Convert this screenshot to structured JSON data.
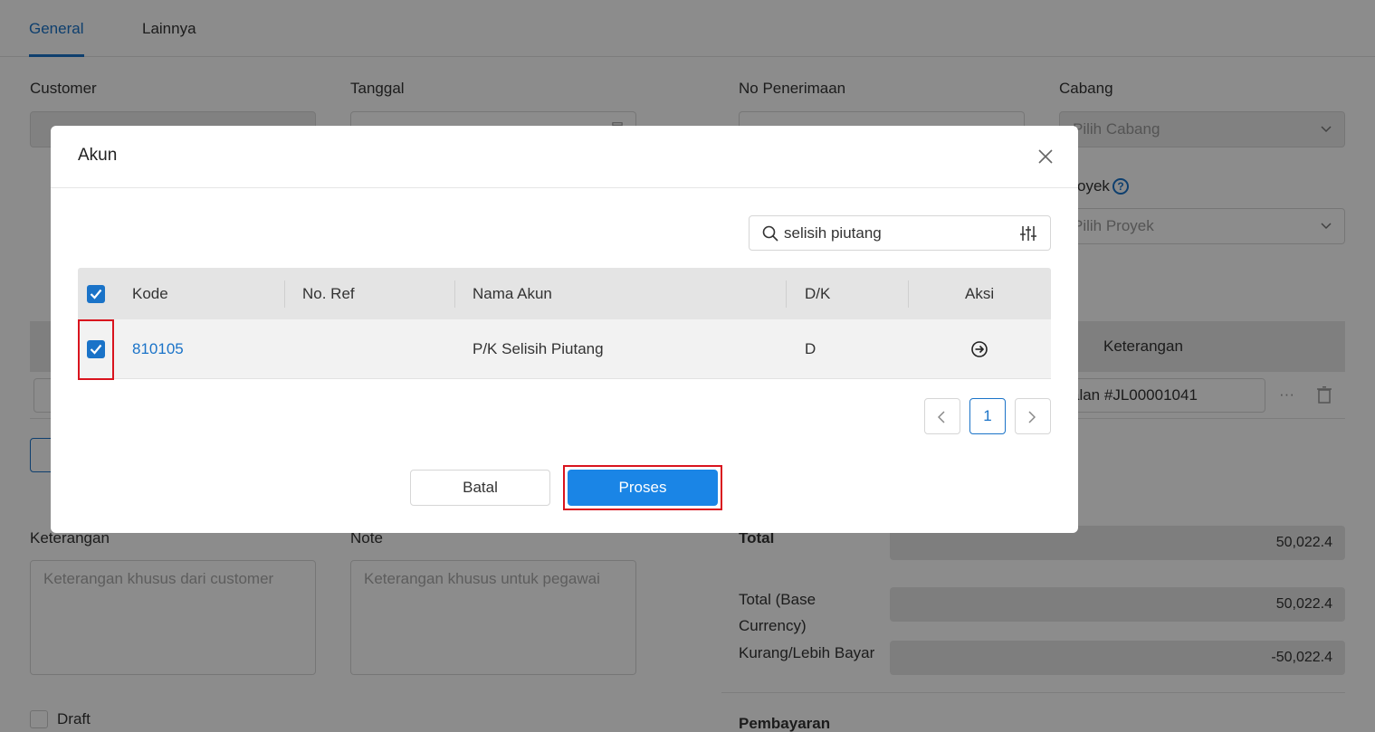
{
  "tabs": [
    {
      "label": "General"
    },
    {
      "label": "Lainnya"
    }
  ],
  "form": {
    "customer_label": "Customer",
    "customer_value": "",
    "tanggal_label": "Tanggal",
    "tanggal_value": "",
    "no_penerimaan_label": "No Penerimaan",
    "no_penerimaan_value": "",
    "cabang_label": "Cabang",
    "cabang_placeholder": "Pilih Cabang",
    "proyek_label": "oyek",
    "proyek_placeholder": "Pilih Proyek",
    "help_glyph": "?"
  },
  "bg_table": {
    "keterangan_header": "Keterangan",
    "row_keterangan_value": "alan #JL00001041",
    "row_more_glyph": "···"
  },
  "bottom": {
    "keterangan_label": "Keterangan",
    "keterangan_placeholder": "Keterangan khusus dari customer",
    "note_label": "Note",
    "note_placeholder": "Keterangan khusus untuk pegawai",
    "draft_label": "Draft",
    "total_label": "Total",
    "total_value": "50,022.4",
    "total_base_label_1": "Total (Base",
    "total_base_label_2": "Currency)",
    "total_base_value": "50,022.4",
    "kurang_label": "Kurang/Lebih Bayar",
    "kurang_value": "-50,022.4",
    "pembayaran_label": "Pembayaran"
  },
  "modal": {
    "title": "Akun",
    "search_value": "selisih piutang",
    "columns": {
      "kode": "Kode",
      "no_ref": "No. Ref",
      "nama_akun": "Nama Akun",
      "dk": "D/K",
      "aksi": "Aksi"
    },
    "rows": [
      {
        "kode": "810105",
        "no_ref": "",
        "nama_akun": "P/K Selisih Piutang",
        "dk": "D",
        "checked": true
      }
    ],
    "pagination": {
      "current_page": "1"
    },
    "cancel_label": "Batal",
    "submit_label": "Proses"
  },
  "colors": {
    "accent": "#1a73c8",
    "primary_button": "#1a85e6",
    "highlight": "#d9141e"
  },
  "icons": [
    "close-icon",
    "search-icon",
    "filter-sliders-icon",
    "arrow-right-circle-icon",
    "chevron-left-icon",
    "chevron-right-icon",
    "chevron-down-icon",
    "calendar-icon",
    "trash-icon",
    "help-icon",
    "check-icon"
  ]
}
